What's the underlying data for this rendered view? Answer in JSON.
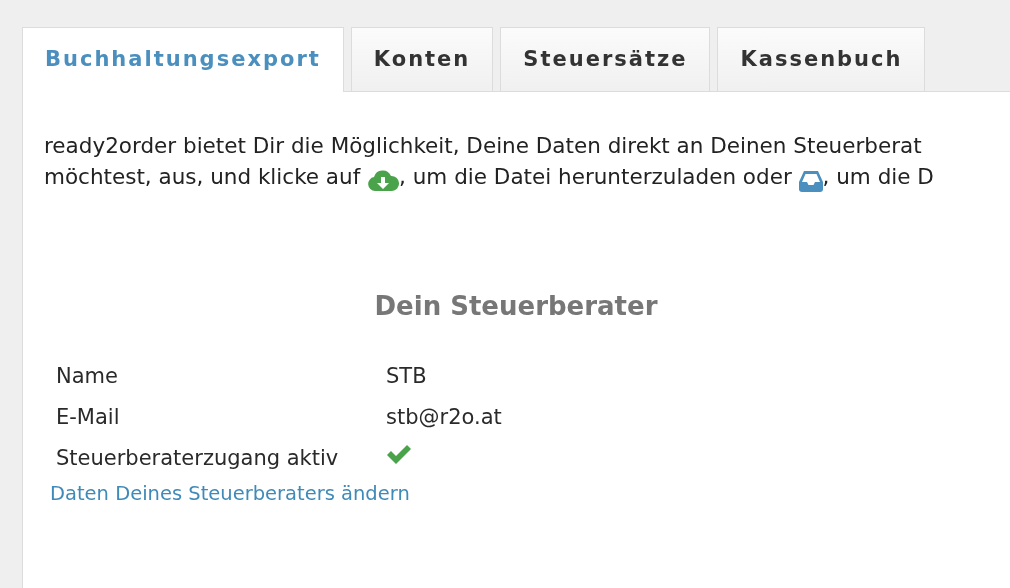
{
  "tabs": [
    {
      "label": "Buchhaltungsexport",
      "selected": true
    },
    {
      "label": "Konten",
      "selected": false
    },
    {
      "label": "Steuersätze",
      "selected": false
    },
    {
      "label": "Kassenbuch",
      "selected": false
    }
  ],
  "intro": {
    "line_1": "ready2order bietet Dir die Möglichkeit, Deine Daten direkt an Deinen Steuerberat",
    "line_2_before_download": "möchtest, aus, und klicke auf",
    "line_2_between": ", um die Datei herunterzuladen oder",
    "line_2_after_inbox": ", um die D"
  },
  "advisor": {
    "heading": "Dein Steuerberater",
    "fields": [
      {
        "kind": "text",
        "label": "Name",
        "value": "STB"
      },
      {
        "kind": "text",
        "label": "E-Mail",
        "value": "stb@r2o.at"
      },
      {
        "kind": "check",
        "label": "Steuerberaterzugang aktiv",
        "active": true
      }
    ],
    "edit_link": "Daten Deines Steuerberaters ändern"
  }
}
